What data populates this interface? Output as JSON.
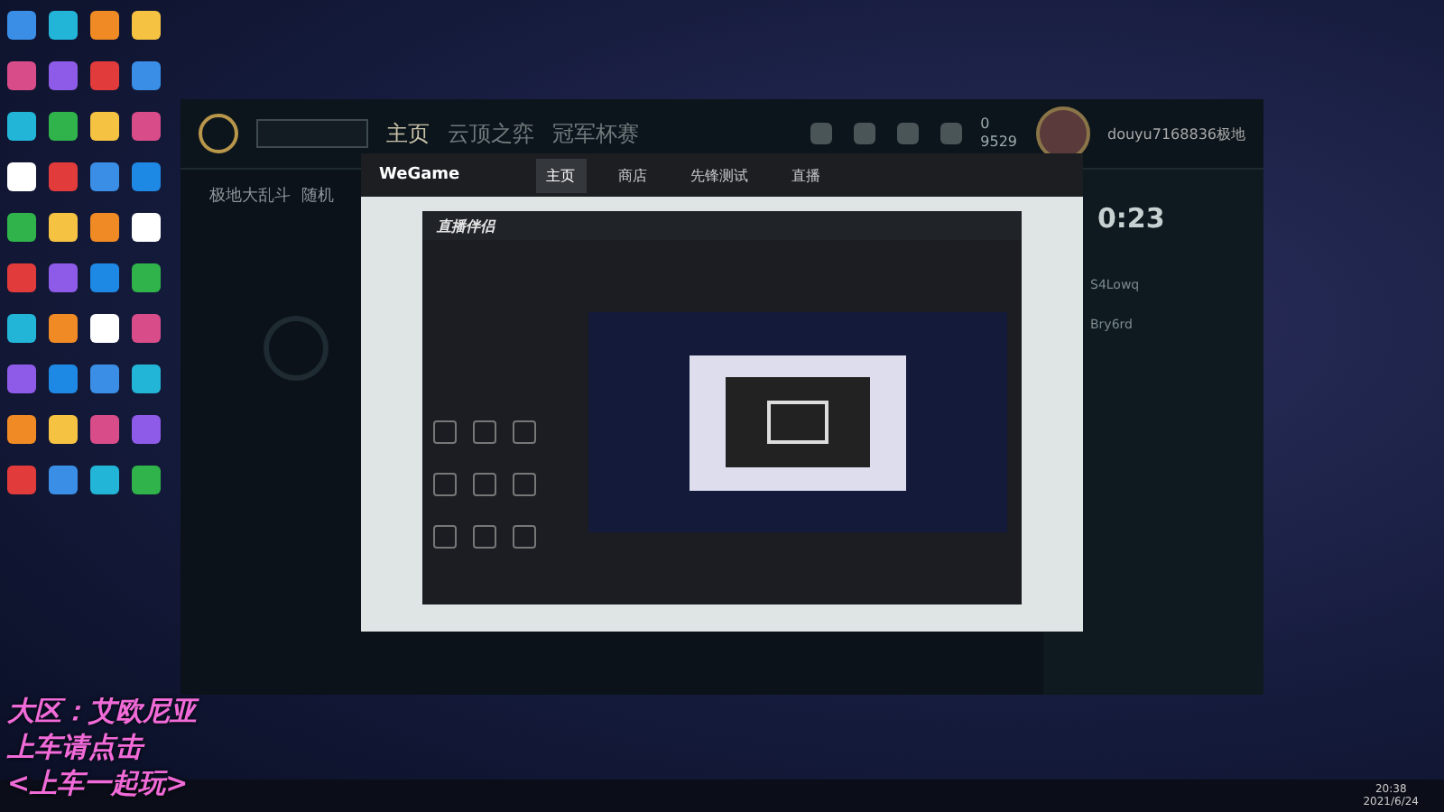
{
  "overlay_text": [
    "大区：艾欧尼亚",
    "上车请点击",
    "<上车一起玩>"
  ],
  "lol_client": {
    "nav": [
      {
        "label": "主页",
        "selected": true
      },
      {
        "label": "云顶之弈",
        "selected": false
      },
      {
        "label": "冠军杯赛",
        "selected": false
      }
    ],
    "currency": [
      "0",
      "9529"
    ],
    "username": "douyu7168836极地",
    "mode": "极地大乱斗",
    "submode": "随机",
    "timer": "0:23",
    "friends": [
      {
        "name": "S4Lowq"
      },
      {
        "name": "Bry6rd"
      }
    ]
  },
  "wegame": {
    "logo": "WeGame",
    "tabs": [
      {
        "label": "主页",
        "selected": true
      },
      {
        "label": "商店",
        "selected": false
      },
      {
        "label": "先锋测试",
        "selected": false
      },
      {
        "label": "直播",
        "selected": false
      }
    ]
  },
  "stream_app": {
    "title": "直播伴侣"
  },
  "clock": {
    "time": "20:38",
    "date": "2021/6/24"
  }
}
